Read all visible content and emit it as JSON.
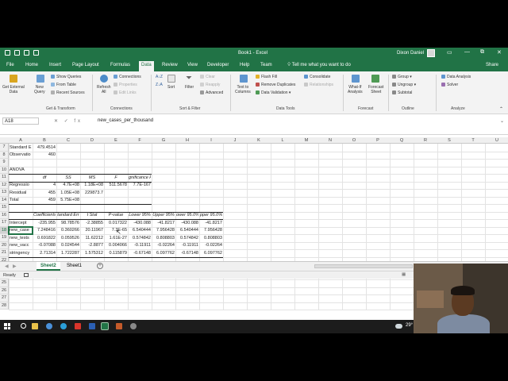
{
  "window": {
    "title": "Book1 - Excel",
    "user": "Dixon Daniel",
    "controls": [
      "—",
      "⧉",
      "✕"
    ]
  },
  "tabs": [
    "File",
    "Home",
    "Insert",
    "Page Layout",
    "Formulas",
    "Data",
    "Review",
    "View",
    "Developer",
    "Help",
    "Team"
  ],
  "active_tab": "Data",
  "tell_me": "Tell me what you want to do",
  "share_label": "Share",
  "ribbon": {
    "get_external_data": "Get External\nData",
    "new_query": "New\nQuery",
    "show_queries": "Show Queries",
    "from_table": "From Table",
    "recent_sources": "Recent Sources",
    "group_get_transform": "Get & Transform",
    "refresh_all": "Refresh\nAll",
    "connections": "Connections",
    "properties": "Properties",
    "edit_links": "Edit Links",
    "group_connections": "Connections",
    "sort": "Sort",
    "filter": "Filter",
    "clear": "Clear",
    "reapply": "Reapply",
    "advanced": "Advanced",
    "group_sort_filter": "Sort & Filter",
    "text_to_columns": "Text to\nColumns",
    "flash_fill": "Flash Fill",
    "remove_duplicates": "Remove Duplicates",
    "data_validation": "Data Validation",
    "consolidate": "Consolidate",
    "relationships": "Relationships",
    "group_data_tools": "Data Tools",
    "what_if": "What-If\nAnalysis",
    "forecast_sheet": "Forecast\nSheet",
    "group_forecast": "Forecast",
    "group_btn": "Group",
    "ungroup": "Ungroup",
    "subtotal": "Subtotal",
    "group_outline": "Outline",
    "data_analysis": "Data Analysis",
    "solver": "Solver",
    "group_analyze": "Analyze"
  },
  "formula_bar": {
    "name_box": "A18",
    "fx_symbols": "✕ ✓ fx",
    "content": "new_cases_per_thousand"
  },
  "columns": [
    "A",
    "B",
    "C",
    "D",
    "E",
    "F",
    "G",
    "H",
    "I",
    "J",
    "K",
    "L",
    "M",
    "N",
    "O",
    "P",
    "Q",
    "R",
    "S",
    "T",
    "U"
  ],
  "rows": [
    7,
    8,
    9,
    10,
    11,
    12,
    13,
    14,
    15,
    16,
    17,
    18,
    19,
    20,
    21,
    22,
    23,
    24,
    25,
    26,
    27,
    28
  ],
  "selected_row": 18,
  "cells": {
    "r7": [
      "Standard E",
      "479.4514"
    ],
    "r8": [
      "Observatio",
      "460"
    ],
    "r10": [
      "ANOVA"
    ],
    "r11": [
      "",
      "df",
      "SS",
      "MS",
      "F",
      "gnificance F"
    ],
    "r12": [
      "Regressio",
      "4",
      "4.7E+08",
      "1.18E+08",
      "511.5678",
      "7.7E-167"
    ],
    "r13": [
      "Residual",
      "455",
      "1.05E+08",
      "229873.7"
    ],
    "r14": [
      "Total",
      "459",
      "5.75E+08"
    ],
    "r16": [
      "",
      "Coefficients",
      "tandard Err",
      "t Stat",
      "P-value",
      "Lower 95%",
      "Upper 95%",
      "ower 95.0%",
      "pper 95.0%"
    ],
    "r17": [
      "Intercept",
      "-235.955",
      "98.78576",
      "-2.38855",
      "0.017322",
      "-430.088",
      "-41.8217",
      "-430.088",
      "-41.8217"
    ],
    "r18": [
      "new_case",
      "7.248416",
      "0.360266",
      "20.11967",
      "7.3E-65",
      "6.540444",
      "7.956428",
      "6.540444",
      "7.956428"
    ],
    "r19": [
      "new_tests",
      "0.691822",
      "0.059526",
      "11.62212",
      "1.61E-27",
      "0.574842",
      "0.808803",
      "0.574842",
      "0.808803"
    ],
    "r20": [
      "new_vacc",
      "-0.07088",
      "0.024544",
      "-2.8877",
      "0.004066",
      "-0.11911",
      "-0.02264",
      "-0.11911",
      "-0.02264"
    ],
    "r21": [
      "stringency",
      "2.71314",
      "1.722287",
      "1.575312",
      "0.115879",
      "-0.67148",
      "6.097762",
      "-0.67148",
      "6.097762"
    ]
  },
  "sheet_tabs": [
    "Sheet2",
    "Sheet1"
  ],
  "active_sheet": "Sheet2",
  "add_sheet": "+",
  "status": "Ready",
  "taskbar": {
    "temperature": "29°"
  },
  "colors": {
    "excel_green": "#217346",
    "ribbon_bg": "#f3f3f3",
    "taskbar": "#1c1c1c"
  }
}
